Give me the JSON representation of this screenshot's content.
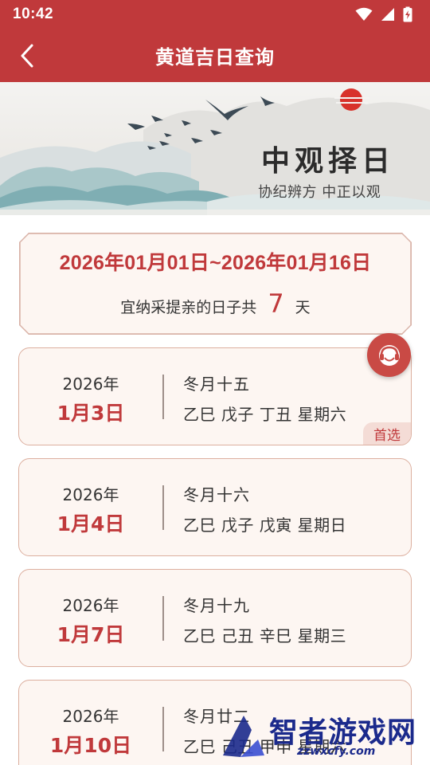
{
  "status_bar": {
    "time": "10:42",
    "icons": [
      "wifi-icon",
      "signal-icon",
      "battery-charging-icon"
    ]
  },
  "app_bar": {
    "title": "黄道吉日查询",
    "back_icon": "chevron-left-icon"
  },
  "banner": {
    "title": "中观择日",
    "subtitle": "协纪辨方 中正以观"
  },
  "summary": {
    "range": "2026年01月01日~2026年01月16日",
    "prefix": "宜纳采提亲的日子共",
    "count": "7",
    "suffix": "天"
  },
  "days": [
    {
      "year": "2026年",
      "date": "1月3日",
      "lunar": "冬月十五",
      "ganzhi": "乙巳 戊子 丁丑 星期六",
      "badge": "首选"
    },
    {
      "year": "2026年",
      "date": "1月4日",
      "lunar": "冬月十六",
      "ganzhi": "乙巳 戊子 戊寅 星期日"
    },
    {
      "year": "2026年",
      "date": "1月7日",
      "lunar": "冬月十九",
      "ganzhi": "乙巳 己丑 辛巳 星期三"
    },
    {
      "year": "2026年",
      "date": "1月10日",
      "lunar": "冬月廿二",
      "ganzhi": "乙巳 己丑 甲申 星期六"
    }
  ],
  "floating": {
    "icon": "customer-service-icon"
  },
  "watermark": {
    "text": "智者游戏网",
    "url": "zzwxcfy.com"
  },
  "colors": {
    "primary": "#c0393b",
    "card_bg": "#fdf6f2",
    "card_border": "#dcaf9f",
    "badge_bg": "#f4dcd6"
  }
}
